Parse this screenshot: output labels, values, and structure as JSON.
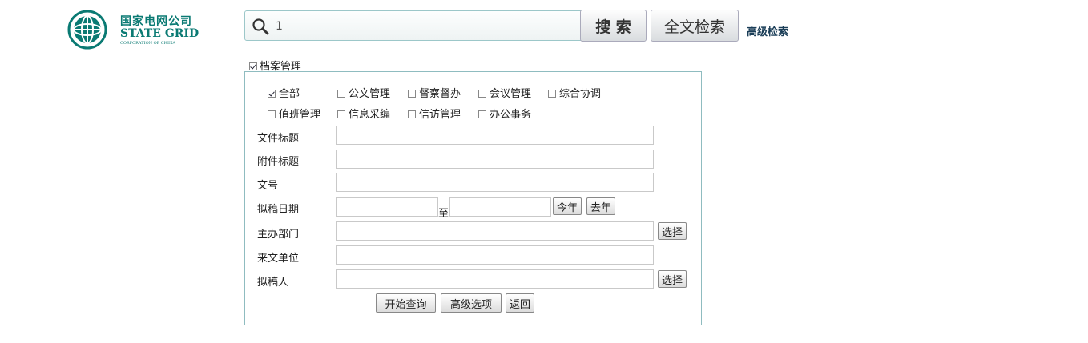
{
  "logo": {
    "cn": "国家电网公司",
    "en": "STATE GRID",
    "sub": "CORPORATION OF CHINA",
    "brand_color": "#0a7a73"
  },
  "search": {
    "value": "1",
    "search_label": "搜 索",
    "fulltext_label": "全文检索",
    "advanced_link": "高级检索"
  },
  "archive": {
    "label": "档案管理",
    "checked": true
  },
  "categories": [
    {
      "label": "全部",
      "checked": true
    },
    {
      "label": "公文管理",
      "checked": false
    },
    {
      "label": "督察督办",
      "checked": false
    },
    {
      "label": "会议管理",
      "checked": false
    },
    {
      "label": "综合协调",
      "checked": false
    },
    {
      "label": "值班管理",
      "checked": false
    },
    {
      "label": "信息采编",
      "checked": false
    },
    {
      "label": "信访管理",
      "checked": false
    },
    {
      "label": "办公事务",
      "checked": false
    }
  ],
  "form": {
    "file_title": "文件标题",
    "attachment_title": "附件标题",
    "doc_number": "文号",
    "draft_date": "拟稿日期",
    "date_to": "至",
    "this_year": "今年",
    "last_year": "去年",
    "host_dept": "主办部门",
    "source_unit": "来文单位",
    "drafter": "拟稿人",
    "select": "选择"
  },
  "actions": {
    "start_query": "开始查询",
    "advanced_options": "高级选项",
    "back": "返回"
  }
}
